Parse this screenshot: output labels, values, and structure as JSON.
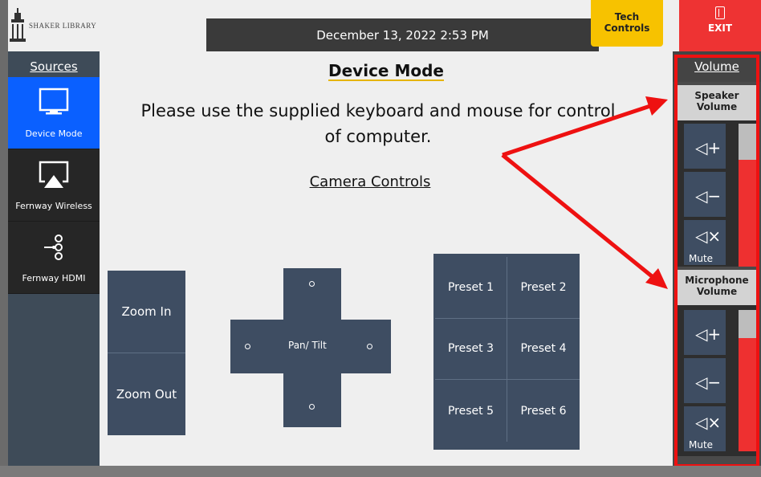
{
  "header": {
    "logo_text": "SHAKER LIBRARY",
    "datetime": "December 13, 2022 2:53 PM",
    "tech_controls_label": "Tech Controls",
    "exit_label": "EXIT"
  },
  "sidebar": {
    "title": "Sources",
    "items": [
      {
        "label": "Device Mode",
        "icon": "monitor-icon",
        "active": true
      },
      {
        "label": "Fernway Wireless",
        "icon": "airplay-icon",
        "active": false
      },
      {
        "label": "Fernway HDMI",
        "icon": "hdmi-input-icon",
        "active": false
      }
    ]
  },
  "main": {
    "mode_title": "Device Mode",
    "instructions": "Please use the supplied keyboard and mouse for control of computer.",
    "camera_title": "Camera Controls",
    "zoom_in": "Zoom In",
    "zoom_out": "Zoom Out",
    "pan_tilt": "Pan/ Tilt",
    "presets": [
      "Preset 1",
      "Preset 2",
      "Preset 3",
      "Preset 4",
      "Preset 5",
      "Preset 6"
    ]
  },
  "volume": {
    "title": "Volume",
    "speaker": {
      "title": "Speaker Volume",
      "mute_label": "Mute",
      "level": 0.75
    },
    "microphone": {
      "title": "Microphone Volume",
      "mute_label": "Mute",
      "level": 0.8
    }
  },
  "colors": {
    "accent_blue": "#0a60ff",
    "tech_yellow": "#f7c200",
    "exit_red": "#ee3333",
    "annotation_red": "#ee1111",
    "button_slate": "#3e4d62"
  }
}
